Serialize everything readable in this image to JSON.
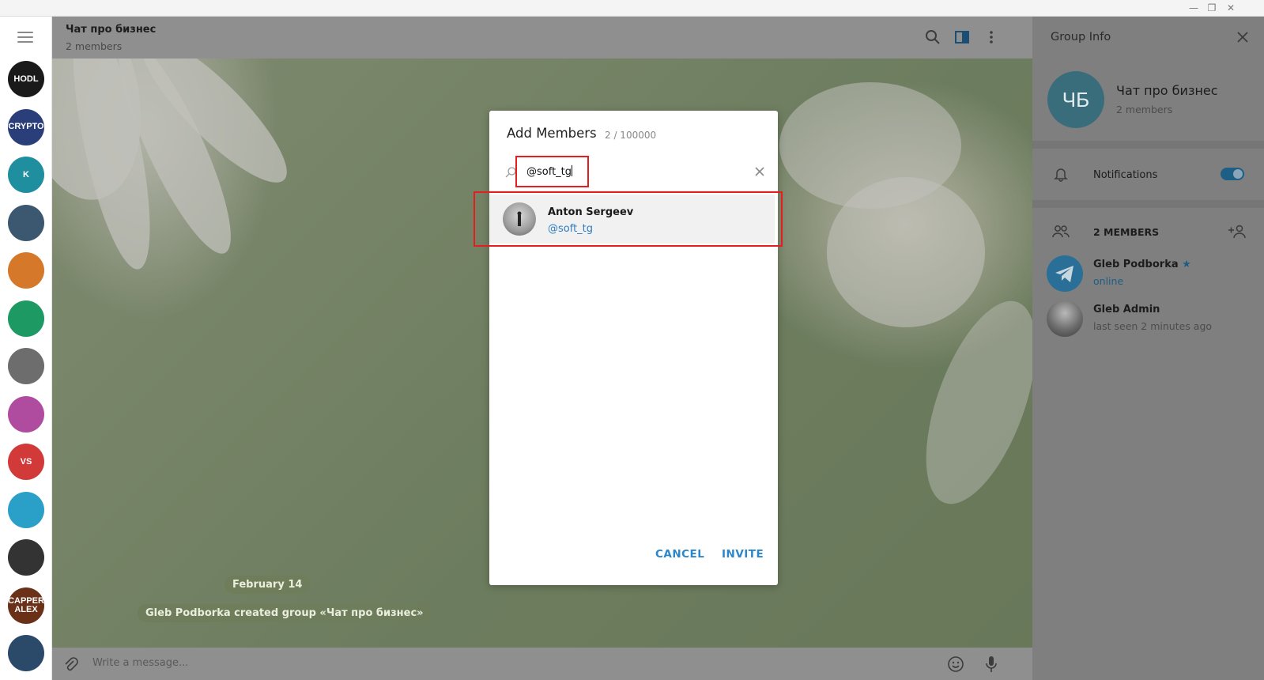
{
  "chat": {
    "title": "Чат про бизнес",
    "subtitle": "2 members",
    "date_label": "February 14",
    "service_message": "Gleb Podborka created group «Чат про бизнес»",
    "composer_placeholder": "Write a message..."
  },
  "sidebar": {
    "avatars": [
      {
        "text": "HODL",
        "color": "#1a1a1a"
      },
      {
        "text": "CRYPTO",
        "color": "#2a3e7a"
      },
      {
        "text": "K",
        "color": "#1f8fa0"
      },
      {
        "text": "",
        "color": "#3c5870"
      },
      {
        "text": "",
        "color": "#d6782a"
      },
      {
        "text": "",
        "color": "#1d9a63"
      },
      {
        "text": "",
        "color": "#6d6d6d"
      },
      {
        "text": "",
        "color": "#b04ca0"
      },
      {
        "text": "VS",
        "color": "#d23a3a"
      },
      {
        "text": "",
        "color": "#2aa0c8"
      },
      {
        "text": "",
        "color": "#333333"
      },
      {
        "text": "CAPPER ALEX",
        "color": "#6a3018"
      },
      {
        "text": "",
        "color": "#2b4a6a"
      }
    ]
  },
  "modal": {
    "title": "Add Members",
    "count": "2 / 100000",
    "search_value": "@soft_tg",
    "result": {
      "name": "Anton Sergeev",
      "username": "@soft_tg"
    },
    "cancel_label": "CANCEL",
    "invite_label": "INVITE"
  },
  "group_info": {
    "title": "Group Info",
    "avatar_initials": "ЧБ",
    "name": "Чат про бизнес",
    "members_count": "2 members",
    "notifications_label": "Notifications",
    "members_header": "2 MEMBERS",
    "members": [
      {
        "name": "Gleb Podborka",
        "status": "online",
        "verified": true
      },
      {
        "name": "Gleb Admin",
        "status": "last seen 2 minutes ago",
        "verified": false
      }
    ]
  }
}
